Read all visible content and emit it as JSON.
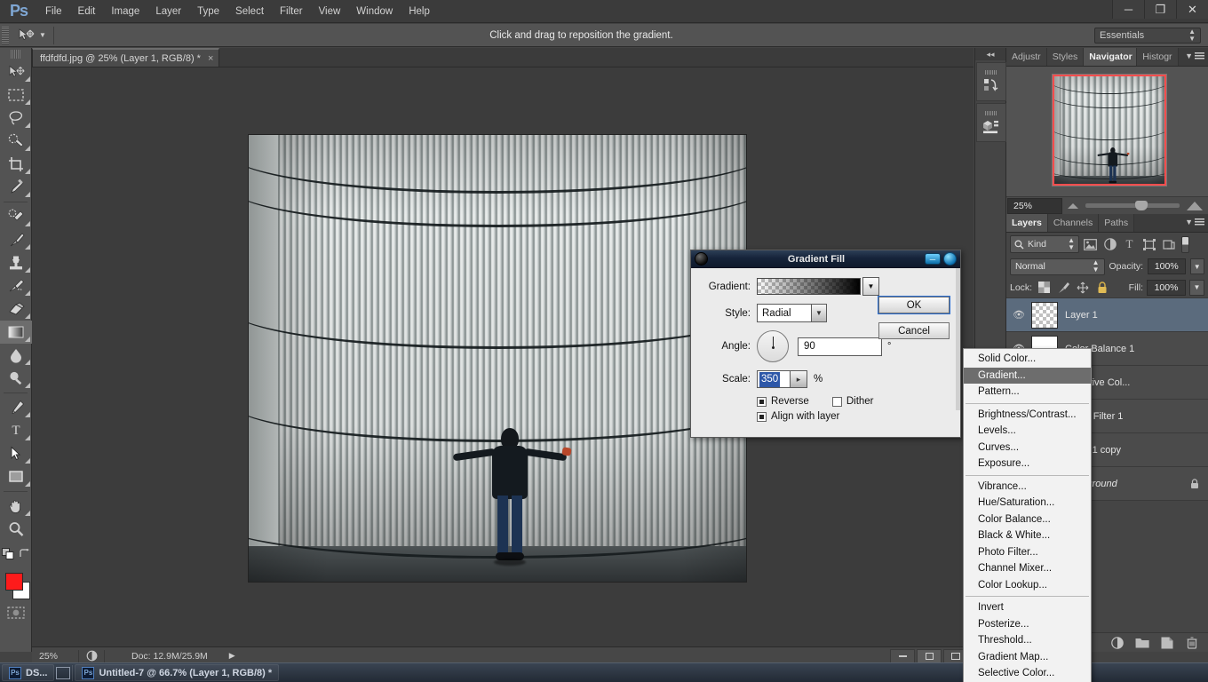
{
  "app": {
    "logo": "Ps",
    "menus": [
      "File",
      "Edit",
      "Image",
      "Layer",
      "Type",
      "Select",
      "Filter",
      "View",
      "Window",
      "Help"
    ],
    "window_buttons": [
      "minimize",
      "restore",
      "close"
    ]
  },
  "options_bar": {
    "tool_icon": "move-tool-icon",
    "hint": "Click and drag to reposition the gradient.",
    "workspace": "Essentials"
  },
  "document": {
    "tab_title": "ffdfdfd.jpg @ 25% (Layer 1, RGB/8) *",
    "close_glyph": "×"
  },
  "toolbar": {
    "tools": [
      {
        "name": "move-tool",
        "glyph": "move"
      },
      {
        "name": "rectangular-marquee-tool",
        "glyph": "marquee"
      },
      {
        "name": "lasso-tool",
        "glyph": "lasso"
      },
      {
        "name": "quick-selection-tool",
        "glyph": "quickselect"
      },
      {
        "name": "crop-tool",
        "glyph": "crop"
      },
      {
        "name": "eyedropper-tool",
        "glyph": "eyedropper"
      },
      {
        "name": "spot-healing-brush-tool",
        "glyph": "healing"
      },
      {
        "name": "brush-tool",
        "glyph": "brush"
      },
      {
        "name": "clone-stamp-tool",
        "glyph": "stamp"
      },
      {
        "name": "history-brush-tool",
        "glyph": "historybrush"
      },
      {
        "name": "eraser-tool",
        "glyph": "eraser"
      },
      {
        "name": "gradient-tool",
        "glyph": "gradient"
      },
      {
        "name": "blur-tool",
        "glyph": "blur"
      },
      {
        "name": "dodge-tool",
        "glyph": "dodge"
      },
      {
        "name": "pen-tool",
        "glyph": "pen"
      },
      {
        "name": "horizontal-type-tool",
        "glyph": "T"
      },
      {
        "name": "path-selection-tool",
        "glyph": "pathselect"
      },
      {
        "name": "rectangle-tool",
        "glyph": "rectangle"
      },
      {
        "name": "hand-tool",
        "glyph": "hand"
      },
      {
        "name": "zoom-tool",
        "glyph": "zoom"
      }
    ],
    "foreground_color": "#fe1b1b",
    "background_color": "#ffffff"
  },
  "status_bar": {
    "zoom": "25%",
    "doc_info": "Doc: 12.9M/25.9M",
    "arrow": "▶"
  },
  "navigator": {
    "tabs": [
      {
        "label": "Adjustr",
        "active": false
      },
      {
        "label": "Styles",
        "active": false
      },
      {
        "label": "Navigator",
        "active": true
      },
      {
        "label": "Histogr",
        "active": false
      }
    ],
    "zoom": "25%"
  },
  "layers_panel": {
    "tabs": [
      {
        "label": "Layers",
        "active": true
      },
      {
        "label": "Channels",
        "active": false
      },
      {
        "label": "Paths",
        "active": false
      }
    ],
    "filter_kind": "Kind",
    "filter_icons": [
      "pixel-filter-icon",
      "adjustment-filter-icon",
      "type-filter-icon",
      "shape-filter-icon",
      "smartobject-filter-icon"
    ],
    "blend_mode": "Normal",
    "opacity_label": "Opacity:",
    "opacity_value": "100%",
    "lock_label": "Lock:",
    "lock_icons": [
      "lock-transparent-icon",
      "lock-image-icon",
      "lock-position-icon",
      "lock-all-icon"
    ],
    "fill_label": "Fill:",
    "fill_value": "100%",
    "layers": [
      {
        "name": "Layer 1",
        "selected": true,
        "thumb": "checker",
        "locked": false,
        "italic": false
      },
      {
        "name": "Color Balance 1",
        "selected": false,
        "thumb": "white",
        "locked": false,
        "italic": false
      },
      {
        "name": "Selective Col...",
        "selected": false,
        "thumb": "white",
        "locked": false,
        "italic": false
      },
      {
        "name": "Photo Filter 1",
        "selected": false,
        "thumb": "white",
        "locked": false,
        "italic": false
      },
      {
        "name": "Layer 1 copy",
        "selected": false,
        "thumb": "image",
        "locked": false,
        "italic": false
      },
      {
        "name": "Background",
        "selected": false,
        "thumb": "image",
        "locked": true,
        "italic": true
      }
    ],
    "footer_icons": [
      "link-layers-icon",
      "layer-style-icon",
      "add-mask-icon",
      "new-adjustment-icon",
      "new-group-icon",
      "new-layer-icon",
      "delete-layer-icon"
    ]
  },
  "dock_strip": {
    "collapse_glyph": "◂◂",
    "buttons": [
      "history-panel-icon",
      "mini-bridge-panel-icon"
    ]
  },
  "dialog": {
    "title": "Gradient Fill",
    "gradient_label": "Gradient:",
    "style_label": "Style:",
    "style_value": "Radial",
    "angle_label": "Angle:",
    "angle_value": "90",
    "angle_unit": "°",
    "scale_label": "Scale:",
    "scale_value": "350",
    "scale_unit": "%",
    "reverse_label": "Reverse",
    "reverse_checked": true,
    "dither_label": "Dither",
    "dither_checked": false,
    "align_label": "Align with layer",
    "align_checked": true,
    "ok_label": "OK",
    "cancel_label": "Cancel"
  },
  "context_menu": {
    "groups": [
      [
        "Solid Color...",
        "Gradient...",
        "Pattern..."
      ],
      [
        "Brightness/Contrast...",
        "Levels...",
        "Curves...",
        "Exposure..."
      ],
      [
        "Vibrance...",
        "Hue/Saturation...",
        "Color Balance...",
        "Black & White...",
        "Photo Filter...",
        "Channel Mixer...",
        "Color Lookup..."
      ],
      [
        "Invert",
        "Posterize...",
        "Threshold...",
        "Gradient Map...",
        "Selective Color..."
      ]
    ],
    "highlighted": "Gradient..."
  },
  "taskbar": {
    "items": [
      {
        "label": "DS...",
        "icon": "ps-icon"
      },
      {
        "label": "Untitled-7 @ 66.7% (Layer 1, RGB/8) *",
        "icon": "ps-icon"
      }
    ]
  },
  "colors": {
    "chrome": "#535353",
    "panel": "#454545",
    "canvas": "#3c3c3c",
    "selection": "#5b6b7d",
    "accent": "#7fa7d4",
    "nav_view_border": "#ff4d4d"
  }
}
